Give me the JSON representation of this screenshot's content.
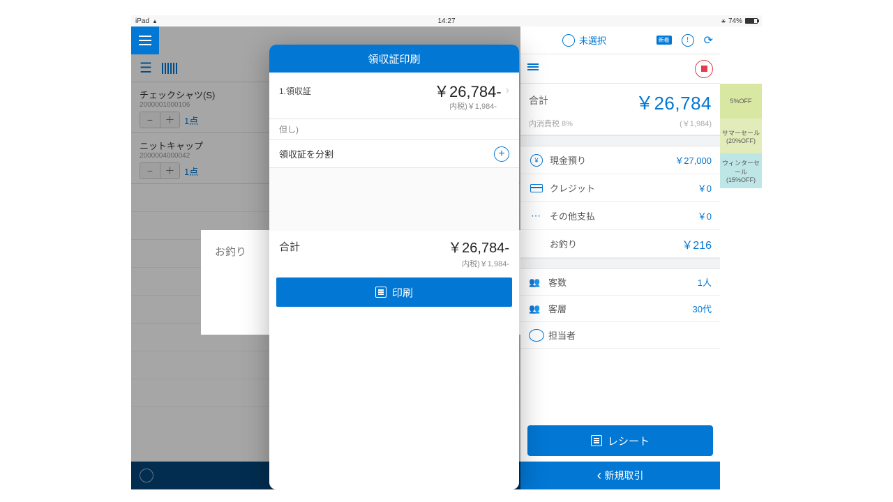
{
  "statusbar": {
    "device": "iPad",
    "time": "14:27",
    "battery": "74%"
  },
  "left": {
    "items": [
      {
        "name": "チェックシャツ(S)",
        "code": "2000001000106",
        "qty": "1点"
      },
      {
        "name": "ニットキャップ",
        "code": "2000004000042",
        "qty": "1点"
      }
    ],
    "change_label": "お釣り"
  },
  "modal": {
    "title": "領収証印刷",
    "r1_label": "1.領収証",
    "r1_value": "￥26,784-",
    "r1_tax": "内税)￥1,984-",
    "but_label": "但し)",
    "split_label": "領収証を分割",
    "total_label": "合計",
    "total_value": "￥26,784-",
    "total_tax": "内税)￥1,984-",
    "print_label": "印刷"
  },
  "right": {
    "user": "未選択",
    "badge_new": "新着",
    "total_label": "合計",
    "total_value": "￥26,784",
    "tax_label": "内消費税 8%",
    "tax_value": "(￥1,984)",
    "pay": [
      {
        "label": "現金預り",
        "value": "￥27,000"
      },
      {
        "label": "クレジット",
        "value": "￥0"
      },
      {
        "label": "その他支払",
        "value": "￥0"
      }
    ],
    "change_label": "お釣り",
    "change_value": "￥216",
    "meta": [
      {
        "label": "客数",
        "value": "1人"
      },
      {
        "label": "客層",
        "value": "30代"
      },
      {
        "label": "担当者",
        "value": ""
      }
    ],
    "receipt_btn": "レシート",
    "footer": "新規取引"
  },
  "sidebadges": [
    {
      "l1": "5%OFF"
    },
    {
      "l1": "サマーセール",
      "l2": "(20%OFF)"
    },
    {
      "l1": "ウィンターセ",
      "l2": "ール",
      "l3": "(15%OFF)"
    }
  ]
}
